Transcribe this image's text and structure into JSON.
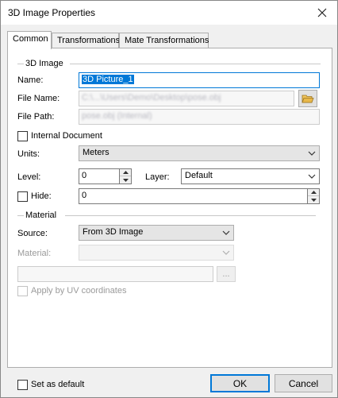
{
  "window": {
    "title": "3D Image Properties"
  },
  "tabs": [
    {
      "label": "Common",
      "active": true
    },
    {
      "label": "Transformations",
      "active": false
    },
    {
      "label": "Mate Transformations",
      "active": false
    }
  ],
  "image_group": {
    "title": "3D Image",
    "name_label": "Name:",
    "name_value": "3D Picture_1",
    "file_name_label": "File Name:",
    "file_name_value": "C:\\...\\Users\\Demo\\Desktop\\pose.obj",
    "file_path_label": "File Path:",
    "file_path_value": "pose.obj (Internal)",
    "internal_document_label": "Internal Document",
    "internal_document_checked": false,
    "units_label": "Units:",
    "units_value": "Meters",
    "level_label": "Level:",
    "level_value": "0",
    "layer_label": "Layer:",
    "layer_value": "Default",
    "hide_label": "Hide:",
    "hide_checked": false,
    "hide_value": "0"
  },
  "material_group": {
    "title": "Material",
    "source_label": "Source:",
    "source_value": "From 3D Image",
    "material_label": "Material:",
    "material_value": "",
    "path_value": "",
    "browse_label": "...",
    "apply_uv_label": "Apply by UV coordinates",
    "apply_uv_checked": false
  },
  "footer": {
    "set_default_label": "Set as default",
    "set_default_checked": false,
    "ok_label": "OK",
    "cancel_label": "Cancel"
  },
  "colors": {
    "accent": "#0078d7",
    "folder": "#e8b84a"
  },
  "icons": [
    "close-icon",
    "folder-open-icon",
    "chevron-down-icon",
    "spin-up-icon",
    "spin-down-icon"
  ]
}
